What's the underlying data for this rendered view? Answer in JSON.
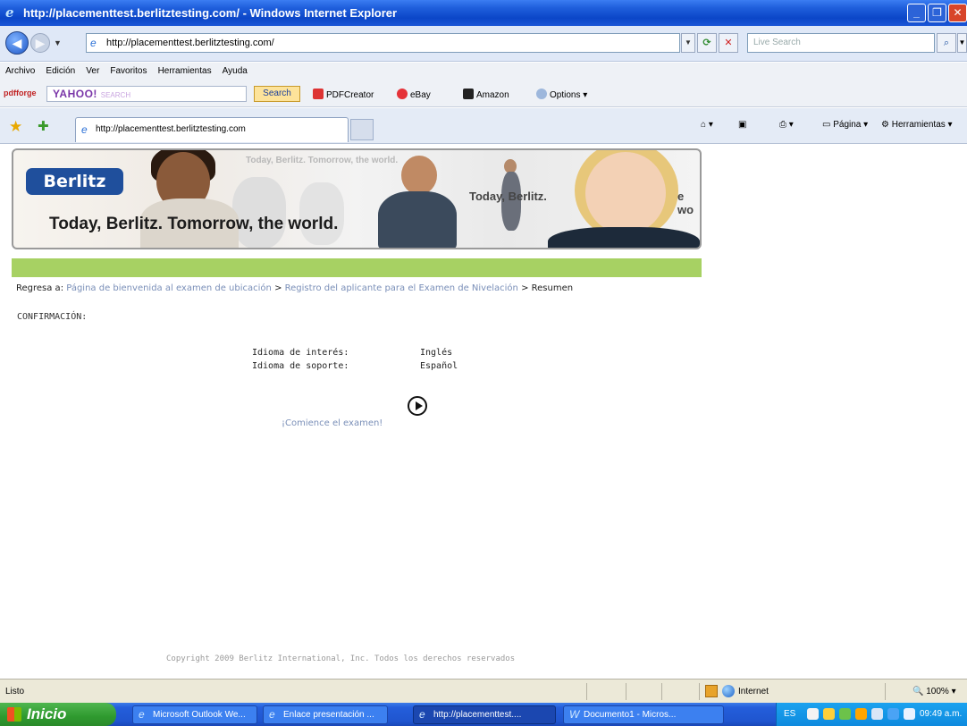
{
  "window": {
    "title": "http://placementtest.berlitztesting.com/ - Windows Internet Explorer"
  },
  "address_bar": {
    "url": "http://placementtest.berlitztesting.com/",
    "search_placeholder": "Live Search"
  },
  "menu": {
    "items": [
      "Archivo",
      "Edición",
      "Ver",
      "Favoritos",
      "Herramientas",
      "Ayuda"
    ]
  },
  "toolbar": {
    "pdfforge_label": "pdfforge",
    "yahoo_label": "YAHOO!",
    "yahoo_hint": "SEARCH",
    "search_button": "Search",
    "pdfcreator": "PDFCreator",
    "ebay": "eBay",
    "amazon": "Amazon",
    "options": "Options"
  },
  "tab": {
    "label": "http://placementtest.berlitztesting.com"
  },
  "commands": {
    "pagina": "Página",
    "herramientas": "Herramientas"
  },
  "banner": {
    "logo": "Berlitz",
    "tagline": "Today, Berlitz. Tomorrow, the world.",
    "faded_tagline": "Today, Berlitz. Tomorrow, the world.",
    "faded_fragment_1": "Today, Berlitz.",
    "faded_fragment_2": "e wo"
  },
  "breadcrumb": {
    "prefix": "Regresa a:",
    "links": [
      "Página de bienvenida al examen de ubicación",
      "Registro del aplicante para el Examen de Nivelación"
    ],
    "current": "Resumen",
    "separator": ">"
  },
  "confirmation": {
    "title": "CONFIRMACIÓN:",
    "rows": [
      {
        "label": "Idioma de interés:",
        "value": "Inglés"
      },
      {
        "label": "Idioma de soporte:",
        "value": "Español"
      }
    ],
    "start_link": "¡Comience el examen!"
  },
  "footer": {
    "copyright": "Copyright 2009 Berlitz International, Inc. Todos los derechos reservados"
  },
  "status_bar": {
    "status": "Listo",
    "zone": "Internet",
    "zoom": "100%"
  },
  "taskbar": {
    "start": "Inicio",
    "tasks": [
      {
        "label": "Microsoft Outlook We...",
        "active": false
      },
      {
        "label": "Enlace presentación ...",
        "active": false
      },
      {
        "label": "http://placementtest....",
        "active": true
      },
      {
        "label": "Documento1 - Micros...",
        "active": false
      }
    ],
    "language": "ES",
    "clock": "09:49 a.m."
  },
  "colors": {
    "accent_green": "#a7d163",
    "link": "#7a8fb8",
    "brand_blue": "#1f4f9c"
  }
}
